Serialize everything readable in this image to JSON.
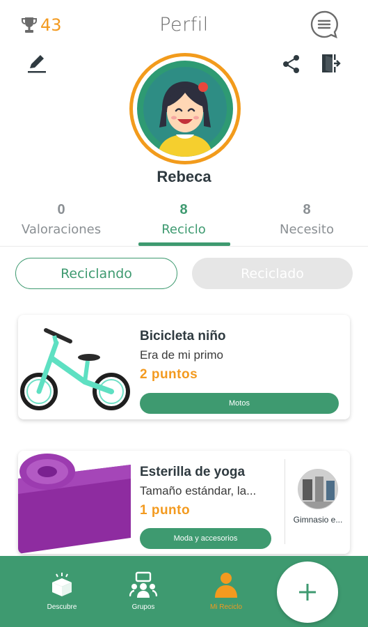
{
  "header": {
    "title": "Perfil",
    "trophy_count": "43"
  },
  "profile": {
    "name": "Rebeca"
  },
  "stats": [
    {
      "count": "0",
      "label": "Valoraciones"
    },
    {
      "count": "8",
      "label": "Reciclo"
    },
    {
      "count": "8",
      "label": "Necesito"
    }
  ],
  "toggle": {
    "left_label": "Reciclando",
    "right_label": "Reciclado"
  },
  "items": [
    {
      "title": "Bicicleta niño",
      "description": "Era de mi primo",
      "points": "2 puntos",
      "tag": "Motos"
    },
    {
      "title": "Esterilla de yoga",
      "description": "Tamaño estándar, la...",
      "points": "1 punto",
      "tag": "Moda y accesorios",
      "group": "Gimnasio e..."
    }
  ],
  "nav": {
    "discover": "Descubre",
    "groups": "Grupos",
    "recycle": "Mi Reciclo"
  },
  "colors": {
    "brand_green": "#3e9a70",
    "accent_orange": "#f39a1f"
  }
}
